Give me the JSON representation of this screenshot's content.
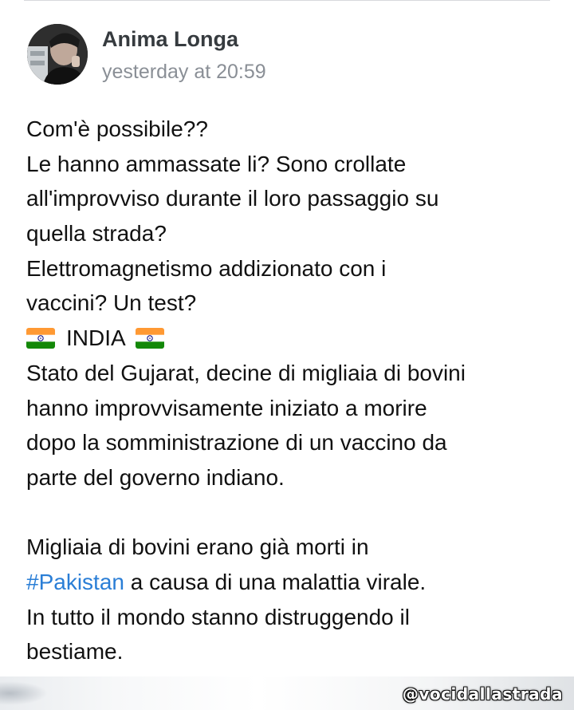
{
  "post": {
    "author": "Anima Longa",
    "timestamp": "yesterday at 20:59",
    "lines": [
      "Com'è possibile??",
      "Le hanno ammassate li? Sono crollate",
      "all'improvviso durante il loro passaggio su",
      "quella strada?",
      "Elettromagnetismo addizionato con i",
      "vaccini? Un test?"
    ],
    "india_label": "INDIA",
    "paragraph_lines": [
      "Stato del Gujarat, decine di migliaia di bovini",
      "hanno improvvisamente iniziato a morire",
      "dopo la somministrazione di un vaccino da",
      "parte del governo indiano."
    ],
    "para2_line1": "Migliaia di bovini erano già morti in",
    "hashtag": "#Pakistan",
    "para2_line2_rest": " a causa di una malattia virale.",
    "para2_line3": "In tutto il mondo stanno distruggendo il",
    "para2_line4": "bestiame."
  },
  "watermark": "@vocidallastrada",
  "icons": {
    "flag": "india-flag-icon",
    "avatar": "profile-photo"
  },
  "colors": {
    "hashtag": "#2a7ed6",
    "author": "#363b3f",
    "timestamp": "#8a8f96"
  }
}
